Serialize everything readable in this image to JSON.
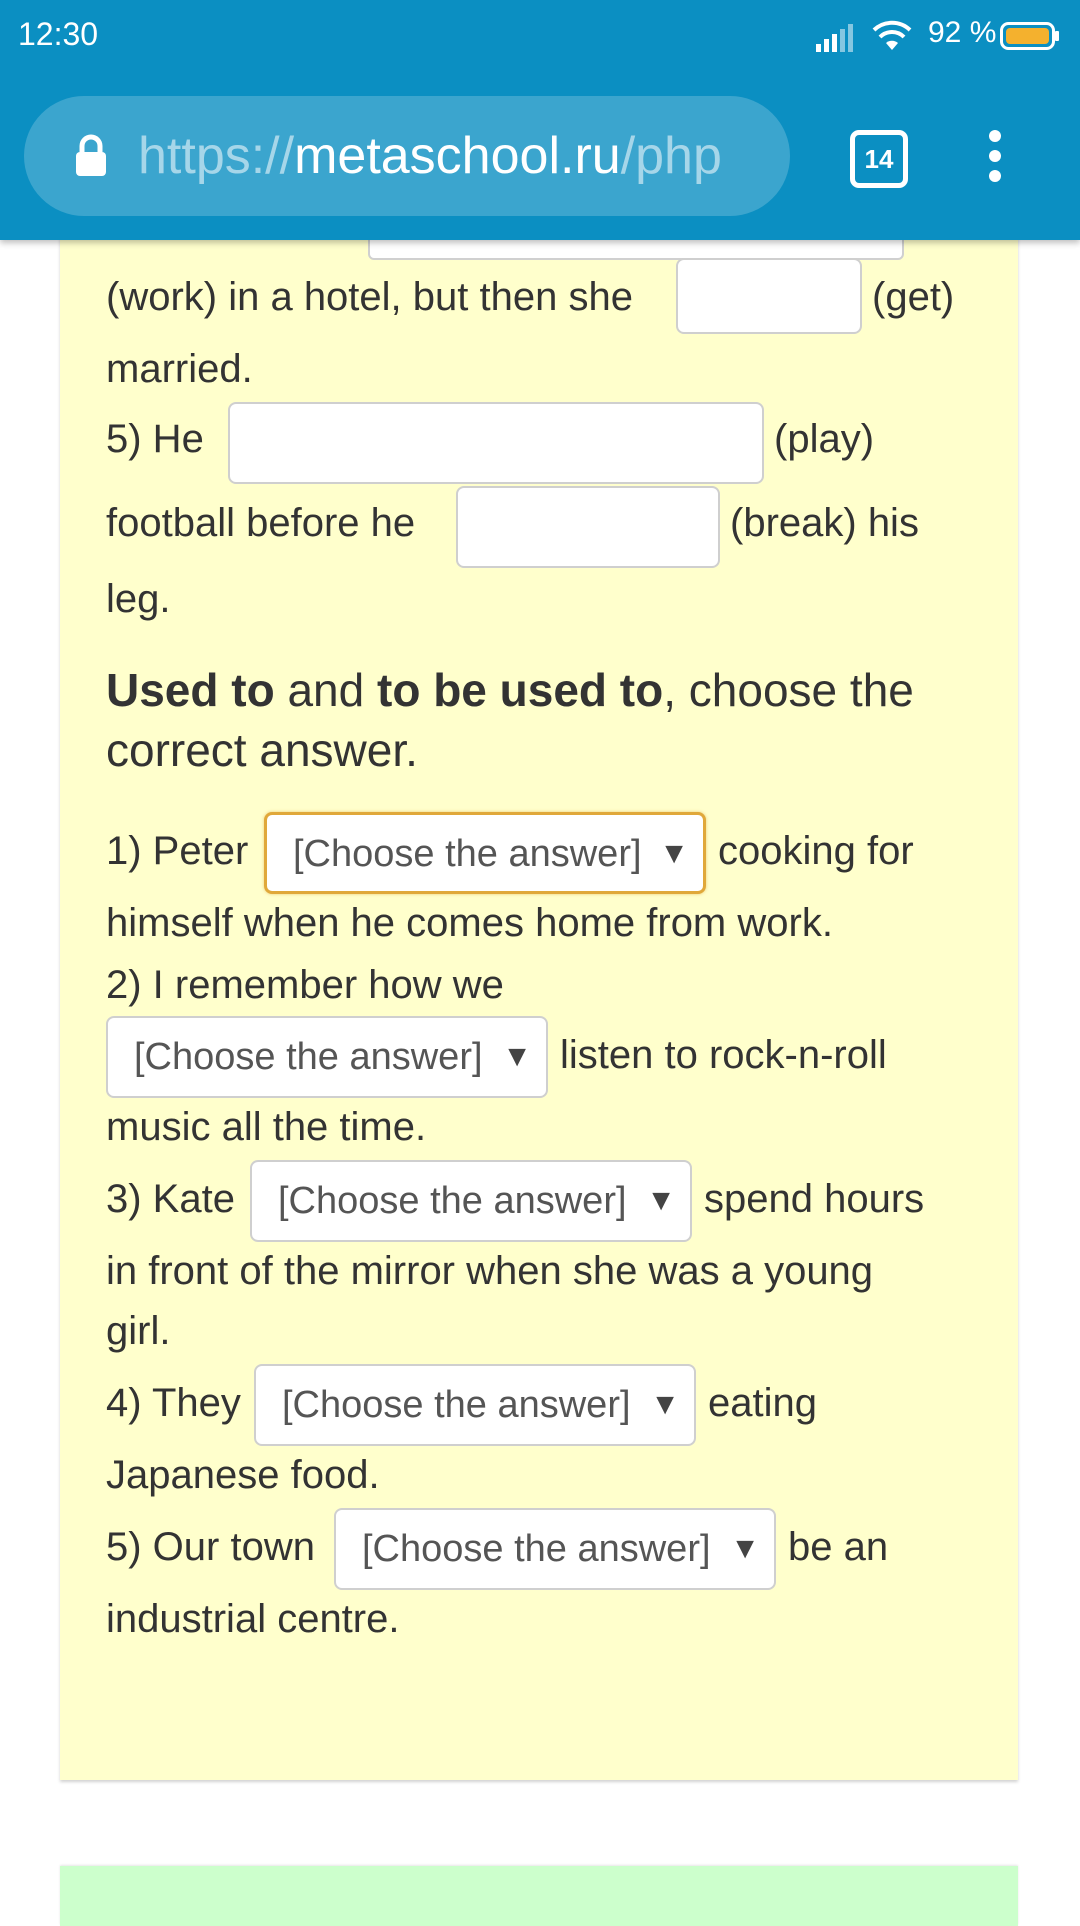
{
  "status_bar": {
    "time": "12:30",
    "battery_percent": "92 %"
  },
  "browser": {
    "url_scheme": "https://",
    "url_host": "metaschool.ru",
    "url_path": "/php",
    "tab_count": "14"
  },
  "exercise_prev": {
    "line_work": "(work) in a hotel, but then she",
    "verb_get": "(get)",
    "married": "married.",
    "item5_prefix": "5) He",
    "verb_play": "(play)",
    "football_before": "football before he",
    "verb_break": "(break) his",
    "leg": "leg."
  },
  "section": {
    "bold1": "Used to",
    "and": " and ",
    "bold2": "to be used to",
    "rest": ", choose the",
    "line2": "correct answer."
  },
  "select_placeholder": "[Choose the answer]",
  "items": {
    "i1_prefix": "1) Peter",
    "i1_after": "cooking for",
    "i1_line2": "himself when he comes home from work.",
    "i2_prefix": "2) I remember how we",
    "i2_after": "listen to rock-n-roll",
    "i2_line2": "music all the time.",
    "i3_prefix": "3) Kate",
    "i3_after": "spend hours",
    "i3_line2": "in front of the mirror when she was a young",
    "i3_line3": "girl.",
    "i4_prefix": "4) They",
    "i4_after": "eating",
    "i4_line2": "Japanese food.",
    "i5_prefix": "5) Our town",
    "i5_after": "be an",
    "i5_line2": "industrial centre."
  },
  "colors": {
    "chrome": "#0b8fc2",
    "card": "#ffffcc",
    "focus": "#e0a83a",
    "next_card": "#ccffcc"
  }
}
